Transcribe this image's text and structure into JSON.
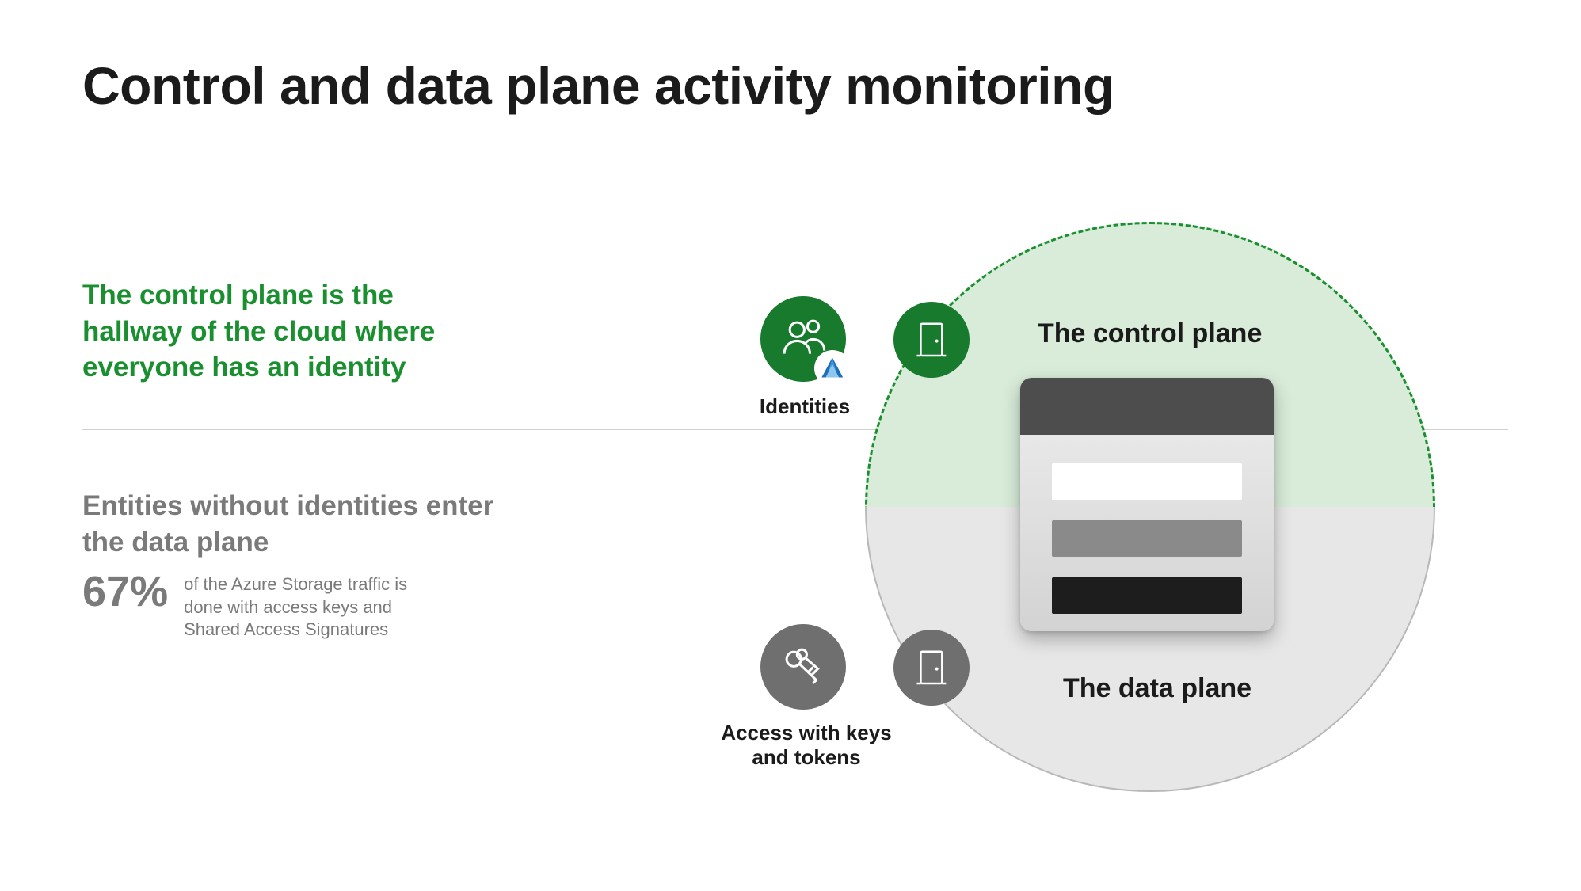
{
  "title": "Control and data plane activity monitoring",
  "control_plane": {
    "description": "The control plane is the hallway of the cloud where everyone has an identity",
    "label": "The control plane",
    "identities_caption": "Identities"
  },
  "data_plane": {
    "heading": "Entities without identities enter the data plane",
    "stat_value": "67%",
    "stat_caption": "of the Azure Storage traffic is done with access keys and Shared Access Signatures",
    "label": "The data plane",
    "access_caption": "Access with keys and tokens"
  },
  "icons": {
    "identities": "people-icon",
    "door_control": "door-icon",
    "keys": "key-icon",
    "door_data": "door-icon",
    "aad_badge": "aad-triangle-icon"
  },
  "colors": {
    "green": "#177a2c",
    "green_light": "#d8ecd9",
    "gray": "#6f6f6f",
    "gray_light": "#e7e7e7",
    "text_muted": "#7a7a7a"
  }
}
